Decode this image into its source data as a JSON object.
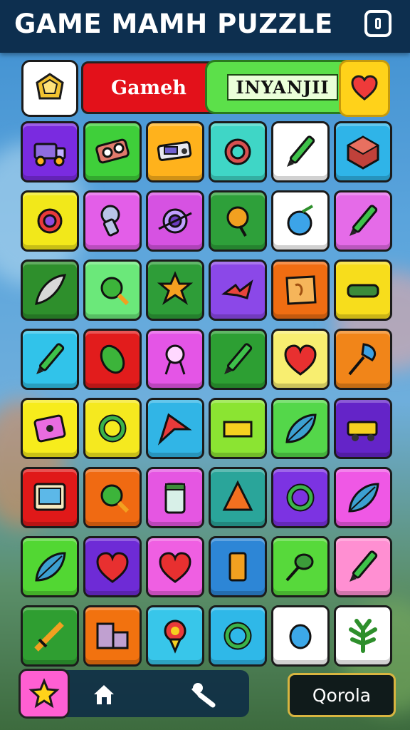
{
  "header": {
    "title": "GAME MAMH PUZZLE"
  },
  "top_row": {
    "red_label": "Gameh",
    "green_label": "INYANJII"
  },
  "grid": [
    {
      "color": "#7a2be0",
      "icon": "truck-icon"
    },
    {
      "color": "#3fcf3a",
      "icon": "gear-box-icon"
    },
    {
      "color": "#ffb21c",
      "icon": "camera-icon"
    },
    {
      "color": "#3fd6c6",
      "icon": "cog-ring-icon"
    },
    {
      "color": "#ffffff",
      "icon": "pencil-icon"
    },
    {
      "color": "#2fb4e8",
      "icon": "crate-icon"
    },
    {
      "color": "#f2e81a",
      "icon": "sun-gear-icon"
    },
    {
      "color": "#e35ee8",
      "icon": "key-tag-icon"
    },
    {
      "color": "#d652e2",
      "icon": "target-icon"
    },
    {
      "color": "#2ea03a",
      "icon": "pin-icon"
    },
    {
      "color": "#ffffff",
      "icon": "apple-blue-icon"
    },
    {
      "color": "#e56be8",
      "icon": "pencil-icon"
    },
    {
      "color": "#2e8f2c",
      "icon": "feather-icon"
    },
    {
      "color": "#6be87a",
      "icon": "magnifier-icon"
    },
    {
      "color": "#2e9d38",
      "icon": "star-burst-icon"
    },
    {
      "color": "#8b48e8",
      "icon": "bow-icon"
    },
    {
      "color": "#f06d12",
      "icon": "map-scroll-icon"
    },
    {
      "color": "#f7dd1c",
      "icon": "box-icon"
    },
    {
      "color": "#31c3ea",
      "icon": "pencil-icon"
    },
    {
      "color": "#e21c1c",
      "icon": "bug-icon"
    },
    {
      "color": "#e455e6",
      "icon": "ring-stand-icon"
    },
    {
      "color": "#2d9f33",
      "icon": "pencil-icon"
    },
    {
      "color": "#f8ee70",
      "icon": "heart-apple-icon"
    },
    {
      "color": "#f18519",
      "icon": "brush-icon"
    },
    {
      "color": "#f7ec1c",
      "icon": "lock-box-icon"
    },
    {
      "color": "#f5e91f",
      "icon": "ring-icon"
    },
    {
      "color": "#31b5e6",
      "icon": "ribbon-icon"
    },
    {
      "color": "#8be432",
      "icon": "bar-icon"
    },
    {
      "color": "#54d74a",
      "icon": "leaf-icon"
    },
    {
      "color": "#6424c8",
      "icon": "cart-icon"
    },
    {
      "color": "#e01919",
      "icon": "tv-icon"
    },
    {
      "color": "#f06a12",
      "icon": "magnifier-icon"
    },
    {
      "color": "#e556e2",
      "icon": "jar-icon"
    },
    {
      "color": "#2aa59a",
      "icon": "cone-icon"
    },
    {
      "color": "#7c33e2",
      "icon": "ring-icon"
    },
    {
      "color": "#ef58e5",
      "icon": "leaf-icon"
    },
    {
      "color": "#52d733",
      "icon": "leaf-icon"
    },
    {
      "color": "#6e2bd6",
      "icon": "heart-icon"
    },
    {
      "color": "#ef5fe2",
      "icon": "heart-icon"
    },
    {
      "color": "#2d86d6",
      "icon": "cup-icon"
    },
    {
      "color": "#57d93b",
      "icon": "spoon-icon"
    },
    {
      "color": "#ff8fd2",
      "icon": "pencil-icon"
    },
    {
      "color": "#2f9e31",
      "icon": "sword-icon"
    },
    {
      "color": "#f2720f",
      "icon": "crates-icon"
    },
    {
      "color": "#38c6ea",
      "icon": "flower-icon"
    },
    {
      "color": "#2fb8e8",
      "icon": "ring-icon"
    },
    {
      "color": "#ffffff",
      "icon": "egg-icon"
    },
    {
      "color": "#ffffff",
      "icon": "palm-leaf-icon"
    }
  ],
  "bottom": {
    "action_label": "Qorola"
  }
}
